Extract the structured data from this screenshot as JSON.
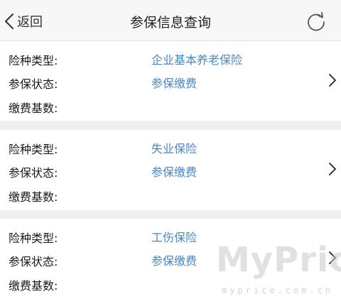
{
  "navbar": {
    "back_label": "返回",
    "title": "参保信息查询",
    "back_icon": "chevron-left-icon",
    "refresh_icon": "refresh-icon"
  },
  "records": [
    {
      "insurance_type_label": "险种类型:",
      "insurance_type_value": "企业基本养老保险",
      "status_label": "参保状态:",
      "status_value": "参保缴费",
      "base_label": "缴费基数:",
      "base_value": ""
    },
    {
      "insurance_type_label": "险种类型:",
      "insurance_type_value": "失业保险",
      "status_label": "参保状态:",
      "status_value": "参保缴费",
      "base_label": "缴费基数:",
      "base_value": ""
    },
    {
      "insurance_type_label": "险种类型:",
      "insurance_type_value": "工伤保险",
      "status_label": "参保状态:",
      "status_value": "参保缴费",
      "base_label": "缴费基数:",
      "base_value": ""
    }
  ],
  "watermark": {
    "main": "MyPrice",
    "sub": "myprice.com.cn"
  },
  "colors": {
    "value_text": "#4a87c0",
    "separator": "#efeff2",
    "navbar_bg": "#f7f7f7"
  }
}
